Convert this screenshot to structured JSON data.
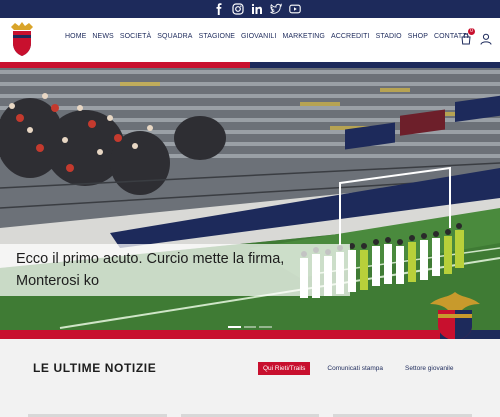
{
  "social": {
    "icons": [
      "facebook-icon",
      "instagram-icon",
      "linkedin-icon",
      "twitter-icon",
      "youtube-icon"
    ]
  },
  "header": {
    "nav": [
      "HOME",
      "NEWS",
      "SOCIETÀ",
      "SQUADRA",
      "STAGIONE",
      "GIOVANILI",
      "MARKETING",
      "ACCREDITI",
      "STADIO",
      "SHOP",
      "CONTATTI"
    ],
    "cart_count": "0"
  },
  "hero": {
    "caption_line1": "Ecco il primo acuto. Curcio mette la firma,",
    "caption_line2": "Monterosi ko"
  },
  "news": {
    "title": "LE ULTIME NOTIZIE",
    "tabs": [
      "Qui Rieti/Trails",
      "Comunicati stampa",
      "Settore giovanile"
    ]
  },
  "colors": {
    "navy": "#1d2a5b",
    "red": "#c8102e",
    "pitch": "#3f7b34"
  }
}
